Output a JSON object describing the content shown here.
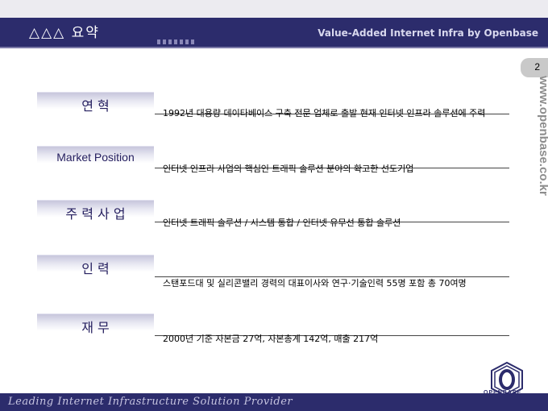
{
  "header": {
    "title": "△△△ 요약",
    "tagline": "Value-Added Internet Infra by Openbase"
  },
  "page_number": "2",
  "side_url": "www.openbase.co.kr",
  "rows": [
    {
      "label": "연   혁",
      "text": "1992년 대용량 데이타베이스 구축 전문 업체로 출발  현재 인터넷 인프라 솔루션에  주력"
    },
    {
      "label": "Market Position",
      "text": "인터넷 인프라 사업의 핵심인 트래픽 솔루션 분야의  확고한 선도기업"
    },
    {
      "label": "주 력 사 업",
      "text": "인터넷 트래픽 솔루션 /  시스템 통합 /  인터넷 유무선 통합 솔루션"
    },
    {
      "label": "인   력",
      "text": "스탠포드대 및 실리콘밸리 경력의  대표이사와  연구·기술인력 55명  포함  총 70여명"
    },
    {
      "label": "재   무",
      "text": "2000년 기준 자본금 27억,  자본총계 142억,   매출 217억"
    }
  ],
  "logo": {
    "name": "OPENBASE"
  },
  "footer": {
    "text": "Leading Internet Infrastructure Solution Provider"
  },
  "colors": {
    "brand": "#2c2c6c",
    "label_text": "#262060"
  }
}
